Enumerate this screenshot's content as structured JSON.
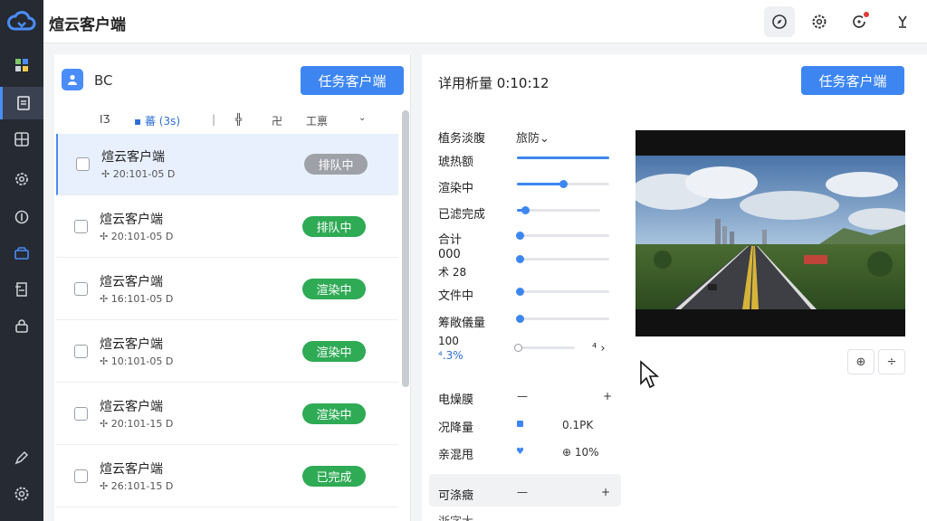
{
  "app": {
    "title": "煊云客户端"
  },
  "left_panel": {
    "name": "BC",
    "primary_button": "任务客户端",
    "toolbar": {
      "item1": "IƷ",
      "item2": "▪ 蕃 (3s)",
      "item3": "|",
      "item4": "╬",
      "item5": "卍",
      "item6": "工禀"
    },
    "rows": [
      {
        "title": "煊云客户端",
        "sub": "✢ 20:101-05 D",
        "status": "排队中",
        "status_color": "#9ea2a8"
      },
      {
        "title": "煊云客户端",
        "sub": "✢ 20:101-05 D",
        "status": "排队中",
        "status_color": "#2faa55"
      },
      {
        "title": "煊云客户端",
        "sub": "✢ 16:101-05 D",
        "status": "渲染中",
        "status_color": "#2faa55"
      },
      {
        "title": "煊云客户端",
        "sub": "✢ 10:101-05 D",
        "status": "渲染中",
        "status_color": "#2faa55"
      },
      {
        "title": "煊云客户端",
        "sub": "✢ 20:101-15 D",
        "status": "渲染中",
        "status_color": "#2faa55"
      },
      {
        "title": "煊云客户端",
        "sub": "✢ 26:101-15 D",
        "status": "已完成",
        "status_color": "#2faa55"
      }
    ]
  },
  "right_panel": {
    "title": "详用析量 0:10:12",
    "primary_button": "任务客户端",
    "props": [
      {
        "label": "植务淡腹",
        "value": "旅防⌄"
      },
      {
        "label": "琥热额",
        "progress": 1.0
      },
      {
        "label": "渲染中",
        "progress": 0.5
      },
      {
        "label": "已滤完成",
        "progress": 0.1
      },
      {
        "label": "合计",
        "progress": 0.03
      },
      {
        "label": "000",
        "label2": "术 28",
        "progress": 0.03
      },
      {
        "label": "文件中",
        "progress": 0.03
      },
      {
        "label": "筹敞儀量",
        "progress": 0.03
      },
      {
        "label": "100",
        "label2": "⁴.3%",
        "progress": 0.02,
        "arrows": "⁴ ›"
      }
    ],
    "props2": [
      {
        "label": "电燥膜",
        "minus": "—",
        "plus": "+"
      },
      {
        "label": "况降量",
        "value": "0.1PK"
      },
      {
        "label": "亲混甩",
        "value": "⊕ 10%"
      }
    ],
    "section": {
      "label": "可涤癥",
      "minus": "—",
      "plus": "+"
    },
    "cut_label": "浙字大",
    "small_buttons": [
      "⊕",
      "÷"
    ]
  },
  "colors": {
    "accent": "#3d86f2",
    "sidebar": "#252a33",
    "success": "#2faa55",
    "muted": "#9ea2a8"
  }
}
